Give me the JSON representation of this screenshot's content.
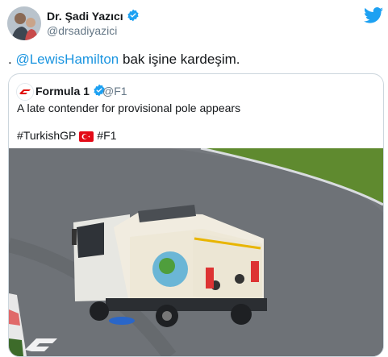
{
  "author": {
    "display_name": "Dr. Şadi Yazıcı",
    "handle": "@drsadiyazici"
  },
  "tweet": {
    "prefix": ". ",
    "mention": "@LewisHamilton",
    "suffix": " bak işine kardeşim."
  },
  "quoted": {
    "display_name": "Formula 1",
    "handle": "@F1",
    "text": "A late contender for provisional pole appears",
    "hashtag_1": "#TurkishGP",
    "hashtag_2": "#F1",
    "flag": "turkey-flag-icon"
  },
  "icons": [
    "twitter-logo-icon",
    "verified-badge-icon",
    "f1-logo-icon",
    "turkey-flag-icon"
  ],
  "colors": {
    "link": "#1b95e0",
    "verified": "#1da1f2",
    "f1_red": "#e10600",
    "muted": "#657786"
  },
  "media": {
    "description_label": "street sweeper truck on wet race track"
  }
}
